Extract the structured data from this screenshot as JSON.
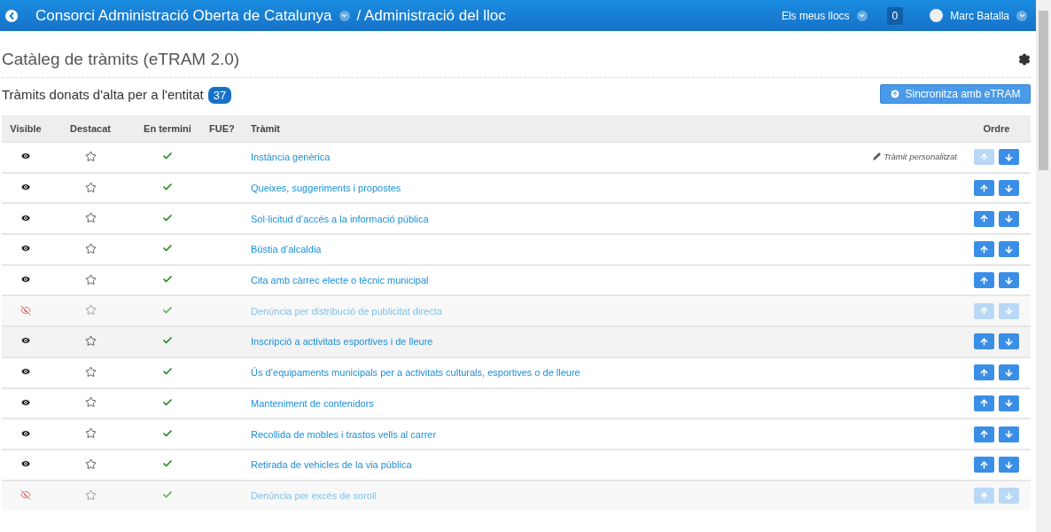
{
  "topbar": {
    "organization": "Consorci Administració Oberta de Catalunya",
    "section": "/ Administració del lloc",
    "my_sites": "Els meus llocs",
    "notifications": "0",
    "user": "Marc Batalla"
  },
  "page": {
    "title": "Catàleg de tràmits (eTRAM 2.0)"
  },
  "summary": {
    "label": "Tràmits donats d'alta per a l'entitat",
    "count": "37",
    "sync_button": "Sincronitza amb eTRAM"
  },
  "table": {
    "columns": [
      "Visible",
      "Destacat",
      "En termini",
      "FUE?",
      "Tràmit",
      "",
      "Ordre"
    ],
    "rows": [
      {
        "visible": true,
        "title": "Instància genèrica",
        "note": "Tràmit personalitzat",
        "up_disabled": true,
        "down_disabled": false,
        "hovered": false
      },
      {
        "visible": true,
        "title": "Queixes, suggeriments i propostes",
        "up_disabled": false,
        "down_disabled": false,
        "hovered": false
      },
      {
        "visible": true,
        "title": "Sol·licitud d’accés a la informació pública",
        "up_disabled": false,
        "down_disabled": false,
        "hovered": false
      },
      {
        "visible": true,
        "title": "Bústia d’alcaldia",
        "up_disabled": false,
        "down_disabled": false,
        "hovered": false
      },
      {
        "visible": true,
        "title": "Cita amb càrrec electe o tècnic municipal",
        "up_disabled": false,
        "down_disabled": false,
        "hovered": false
      },
      {
        "visible": false,
        "title": "Denúncia per distribució de publicitat directa",
        "up_disabled": true,
        "down_disabled": true,
        "hovered": false
      },
      {
        "visible": true,
        "title": "Inscripció a activitats esportives i de lleure",
        "up_disabled": false,
        "down_disabled": false,
        "hovered": true
      },
      {
        "visible": true,
        "title": "Ús d’equipaments municipals per a activitats culturals, esportives o de lleure",
        "up_disabled": false,
        "down_disabled": false,
        "hovered": false
      },
      {
        "visible": true,
        "title": "Manteniment de contenidors",
        "up_disabled": false,
        "down_disabled": false,
        "hovered": false
      },
      {
        "visible": true,
        "title": "Recollida de mobles i trastos vells al carrer",
        "up_disabled": false,
        "down_disabled": false,
        "hovered": false
      },
      {
        "visible": true,
        "title": "Retirada de vehicles de la via pública",
        "up_disabled": false,
        "down_disabled": false,
        "hovered": false
      },
      {
        "visible": false,
        "title": "Denúncia per excés de soroll",
        "up_disabled": true,
        "down_disabled": true,
        "hovered": false
      }
    ]
  }
}
